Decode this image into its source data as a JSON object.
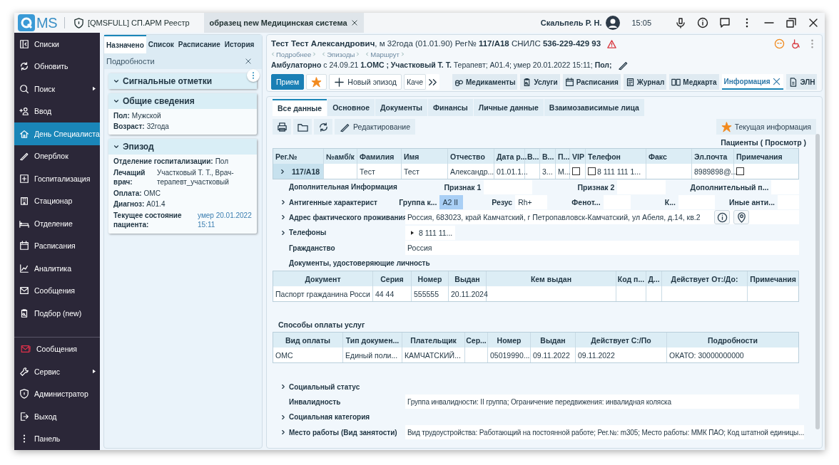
{
  "titlebar": {
    "logo": "MS",
    "tabs": [
      {
        "label": "[QMSFULL] СП.АРМ Реестр",
        "selected": false
      },
      {
        "label": "образец new Медицинская система",
        "selected": true
      }
    ],
    "user": "Скальпель Р. Н.",
    "time": "15:05"
  },
  "sidebar": {
    "top": [
      {
        "label": "Списки",
        "selected": false,
        "submenu": false
      },
      {
        "label": "Обновить",
        "selected": false,
        "submenu": false
      },
      {
        "label": "Поиск",
        "selected": false,
        "submenu": true
      },
      {
        "label": "Ввод",
        "selected": false,
        "submenu": false
      },
      {
        "label": "День Специалиста",
        "selected": true,
        "submenu": false
      },
      {
        "label": "Оперблок",
        "selected": false,
        "submenu": false
      },
      {
        "label": "Госпитализация",
        "selected": false,
        "submenu": false
      },
      {
        "label": "Стационар",
        "selected": false,
        "submenu": false
      },
      {
        "label": "Отделение",
        "selected": false,
        "submenu": false
      },
      {
        "label": "Расписания",
        "selected": false,
        "submenu": false
      },
      {
        "label": "Аналитика",
        "selected": false,
        "submenu": false
      },
      {
        "label": "Сообщения",
        "selected": false,
        "submenu": false
      },
      {
        "label": "Подбор (new)",
        "selected": false,
        "submenu": false
      }
    ],
    "bottom": [
      {
        "label": "Сообщения",
        "selected": false,
        "submenu": false,
        "alert": true
      },
      {
        "label": "Сервис",
        "selected": false,
        "submenu": true,
        "alert": false
      },
      {
        "label": "Администратор",
        "selected": false,
        "submenu": false,
        "alert": false
      },
      {
        "label": "Выход",
        "selected": false,
        "submenu": false,
        "alert": false
      },
      {
        "label": "Панель",
        "selected": false,
        "submenu": false,
        "alert": false
      }
    ]
  },
  "left_panel": {
    "tabs": [
      {
        "label": "Назначено",
        "selected": true
      },
      {
        "label": "Список",
        "selected": false
      },
      {
        "label": "Расписание",
        "selected": false
      },
      {
        "label": "История",
        "selected": false
      }
    ],
    "header": "Подробности",
    "cards": [
      {
        "title": "Сигнальные отметки",
        "expanded": true,
        "has_menu": true
      },
      {
        "title": "Общие сведения",
        "expanded": true,
        "has_menu": false,
        "fields": [
          {
            "kind": "inline",
            "label": "Пол:",
            "value": "Мужской"
          },
          {
            "kind": "inline",
            "label": "Возраст:",
            "value": "32года"
          }
        ]
      },
      {
        "title": "Эпизод",
        "expanded": true,
        "has_menu": false,
        "fields": [
          {
            "kind": "inline",
            "label": "Отделение госпитализации:",
            "value": "Пол"
          },
          {
            "kind": "column",
            "label": "Лечащий врач:",
            "value": "Участковый Т. Т., Врач-терапевт_участковый"
          },
          {
            "kind": "inline",
            "label": "Оплата:",
            "value": "ОМС"
          },
          {
            "kind": "inline",
            "label": "Диагноз:",
            "value": "A01.4"
          },
          {
            "kind": "status",
            "label": "Текущее состояние пациента:",
            "value": "умер 20.01.2022 15:11"
          }
        ]
      }
    ]
  },
  "patient": {
    "summary": "**Тест Тест Александрович**, м 32года (01.01.90) Рег№ **117/А18** СНИЛС **536-229-429 93**",
    "links": [
      "Подробнее",
      "Эпизоды",
      "Маршрут"
    ],
    "episode": "**Амбулаторно** с 24.09.21 **1.ОМС ; Участковый Т. Т.** Терапевт; A01.4; умер 20.01.2022 15:11; **Пол;**"
  },
  "toolbar": {
    "primary": "Прием",
    "new_episode": "Новый эпизод",
    "cut_button": "Каче",
    "tabs": [
      {
        "label": "Медикаменты",
        "selected": false
      },
      {
        "label": "Услуги",
        "selected": false
      },
      {
        "label": "Расписания",
        "selected": false
      },
      {
        "label": "Журнал",
        "selected": false
      },
      {
        "label": "Медкарта",
        "selected": false
      },
      {
        "label": "Информация",
        "selected": true
      },
      {
        "label": "ЭЛН",
        "selected": false
      }
    ]
  },
  "content": {
    "tabs": [
      {
        "label": "Все данные",
        "selected": true
      },
      {
        "label": "Основное",
        "selected": false
      },
      {
        "label": "Документы",
        "selected": false
      },
      {
        "label": "Финансы",
        "selected": false
      },
      {
        "label": "Личные данные",
        "selected": false
      },
      {
        "label": "Взаимозависимые лица",
        "selected": false
      }
    ],
    "edit": "Редактирование",
    "current_info": "Текущая информация",
    "title": "Пациенты ( Просмотр )",
    "patients": {
      "columns": [
        "Рег.№",
        "№амб/к",
        "Фамилия",
        "Имя",
        "Отчество",
        "Дата р...",
        "В...",
        "В...",
        "П...",
        "VIP",
        "Телефон",
        "Факс",
        "Эл.почта",
        "Примечания"
      ],
      "rows": [
        {
          "selected": true,
          "expandable": true,
          "cells": [
            {
              "kind": "text",
              "text": "117/А18"
            },
            {
              "kind": "text"
            },
            {
              "kind": "text",
              "text": "Тест"
            },
            {
              "kind": "text",
              "text": "Тест"
            },
            {
              "kind": "text",
              "text": "Александр..."
            },
            {
              "kind": "text",
              "text": "01.01.1..."
            },
            {
              "kind": "text"
            },
            {
              "kind": "text",
              "text": "3..."
            },
            {
              "kind": "text",
              "text": "М..."
            },
            {
              "kind": "check",
              "checked": false
            },
            {
              "kind": "check",
              "checked": false,
              "text": "8 111 111 1..."
            },
            {
              "kind": "text"
            },
            {
              "kind": "text",
              "text": "8989898@..."
            },
            {
              "kind": "check",
              "checked": false
            }
          ]
        }
      ]
    },
    "details": [
      {
        "kind": "pairs",
        "label": "Дополнительная Информация",
        "expandable": false,
        "pairs": [
          {
            "label": "Признак 1",
            "selected": false
          },
          {
            "label": "Признак 2",
            "selected": false
          },
          {
            "label": "Дополнительный п...",
            "selected": false
          }
        ]
      },
      {
        "kind": "pairs",
        "label": "Антигенные характерист",
        "expandable": true,
        "pairs": [
          {
            "label": "Группа к...",
            "value": "A2 II",
            "selected": true
          },
          {
            "label": "Резус",
            "value": "Rh+",
            "selected": false
          },
          {
            "label": "Фенот...",
            "selected": false
          },
          {
            "label": "К...",
            "selected": false
          },
          {
            "label": "Иные анти...",
            "selected": false
          }
        ]
      },
      {
        "kind": "address",
        "label": "Адрес фактического проживания",
        "expandable": true,
        "value": "Россия, 683023, край Камчатский, г Петропавловск-Камчатский, ул Абеля, д.14, кв.2"
      },
      {
        "kind": "list",
        "label": "Телефоны",
        "expandable": true,
        "value": "8 111 11..."
      },
      {
        "kind": "field",
        "label": "Гражданство",
        "expandable": false,
        "value": "Россия"
      }
    ],
    "documents": {
      "title": "Документы, удостоверяющие личность",
      "columns": [
        "Документ",
        "Серия",
        "Номер",
        "Выдан",
        "Кем выдан",
        "Код п...",
        "Д...",
        "Действует От:/До:",
        "Примечания"
      ],
      "rows": [
        [
          "Паспорт гражданина Росси",
          "44 44",
          "555555",
          "20.11.2024",
          null,
          null,
          null,
          null,
          null
        ]
      ]
    },
    "payments": {
      "title": "Способы оплаты услуг",
      "columns": [
        "Вид оплаты",
        "Тип докумен...",
        "Плательщик",
        "Сер...",
        "Номер",
        "Выдан",
        "Действует С:/По",
        "Подробности"
      ],
      "rows": [
        [
          "ОМС",
          "Единый поли...",
          "КАМЧАТСКИЙ...",
          null,
          "05019990...",
          "09.11.2022",
          "09.11.2022",
          "ОКАТО: 30000000000"
        ]
      ]
    },
    "social": [
      {
        "kind": "section",
        "label": "Социальный статус",
        "expandable": true
      },
      {
        "kind": "field",
        "label": "Инвалидность",
        "expandable": false,
        "value": "Группа инвалидности: II группа; Ограничение передвижения: инвалидная коляска"
      },
      {
        "kind": "section",
        "label": "Социальная категория",
        "expandable": true
      },
      {
        "kind": "field",
        "label": "Место работы (Вид занятости)",
        "expandable": true,
        "value": "Вид трудоустройства: Работающий на постоянной работе; Рег.№: m305; Место работы: ММК ПАО; Код штатной единицы..."
      }
    ]
  }
}
